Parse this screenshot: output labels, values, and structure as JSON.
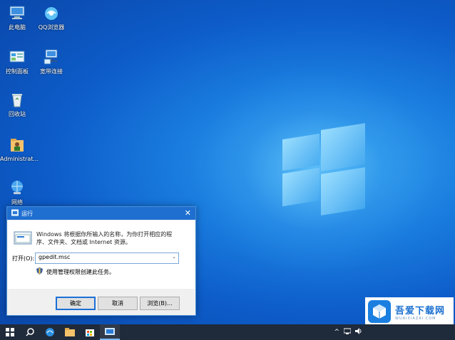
{
  "desktop_icons": [
    {
      "label": "此电脑",
      "icon": "this-pc-icon"
    },
    {
      "label": "QQ浏览器",
      "icon": "qq-browser-icon"
    },
    {
      "label": "控制面板",
      "icon": "control-panel-icon"
    },
    {
      "label": "宽带连接",
      "icon": "network-icon"
    },
    {
      "label": "回收站",
      "icon": "recycle-bin-icon"
    },
    {
      "label": "Administrat...",
      "icon": "user-folder-icon"
    },
    {
      "label": "网络",
      "icon": "network-globe-icon"
    }
  ],
  "run_dialog": {
    "title": "运行",
    "description": "Windows 将根据你所输入的名称，为你打开相应的程序、文件夹、文档或 Internet 资源。",
    "open_label": "打开(O):",
    "input_value": "gpedit.msc",
    "admin_note": "使用管理权限创建此任务。",
    "buttons": {
      "ok": "确定",
      "cancel": "取消",
      "browse": "浏览(B)..."
    }
  },
  "watermark": {
    "brand": "吾爱下载网",
    "url": "WUAIXIAZAI.COM"
  },
  "colors": {
    "accent": "#1e6fd0",
    "taskbar": "#1f2a3a"
  }
}
